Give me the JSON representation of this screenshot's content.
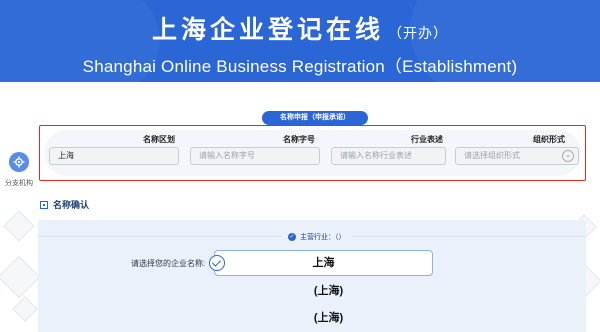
{
  "header": {
    "title_cn": "上海企业登记在线",
    "title_suffix": "（开办）",
    "title_en": "Shanghai Online Business Registration（Establishment)"
  },
  "side_nav": {
    "icon": "gear-icon",
    "label": "分支机构"
  },
  "name_application": {
    "section_title": "名称申报（申报承诺）",
    "fields": [
      {
        "label": "名称区划",
        "value": "上海",
        "placeholder": ""
      },
      {
        "label": "名称字号",
        "value": "",
        "placeholder": "请输入名称字号"
      },
      {
        "label": "行业表述",
        "value": "",
        "placeholder": "请输入名称行业表述"
      },
      {
        "label": "组织形式",
        "value": "",
        "placeholder": "请选择组织形式"
      }
    ]
  },
  "name_confirm": {
    "heading": "名称确认",
    "industry_label": "主营行业：（）",
    "select_label": "请选择您的企业名称:",
    "options": [
      "上海",
      "(上海)",
      "(上海)"
    ]
  },
  "colors": {
    "brand_blue": "#2a66d6",
    "error_red": "#e02a2a",
    "panel_bg": "#eaf1fb"
  }
}
